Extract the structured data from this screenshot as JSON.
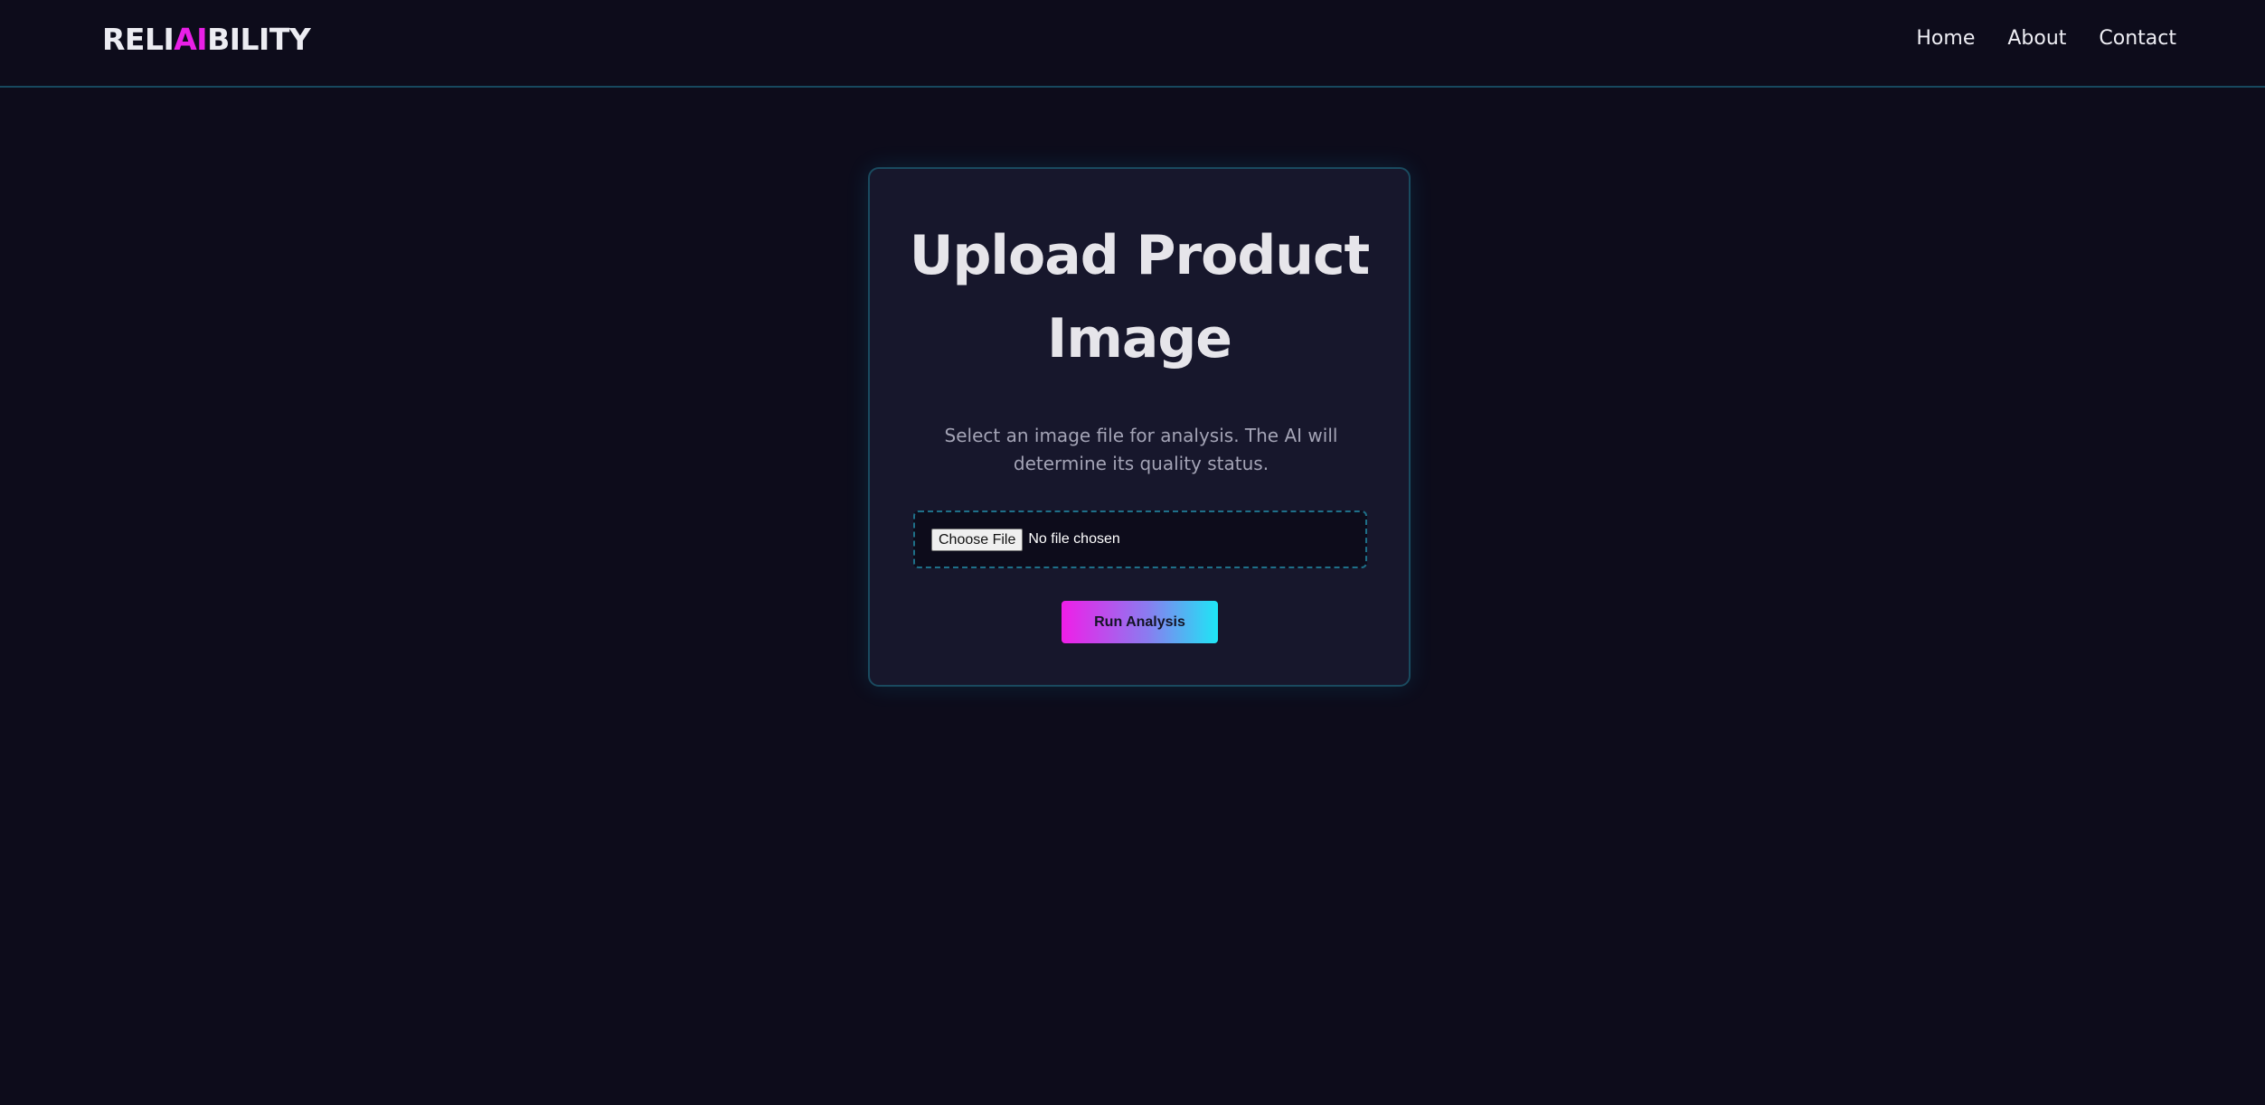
{
  "header": {
    "logo": {
      "part1": "RELI",
      "part2": "AI",
      "part3": "BILITY"
    },
    "nav": [
      {
        "label": "Home"
      },
      {
        "label": "About"
      },
      {
        "label": "Contact"
      }
    ]
  },
  "card": {
    "title": "Upload Product Image",
    "description": "Select an image file for analysis. The AI will determine its quality status.",
    "file_input": {
      "button_label": "Choose File",
      "status": "No file chosen"
    },
    "run_button_label": "Run Analysis"
  },
  "colors": {
    "background": "#0d0c1b",
    "card_background": "#17172c",
    "accent_magenta": "#e91fe6",
    "accent_cyan": "#1ee6f5",
    "border_teal": "#1a4a5f"
  }
}
